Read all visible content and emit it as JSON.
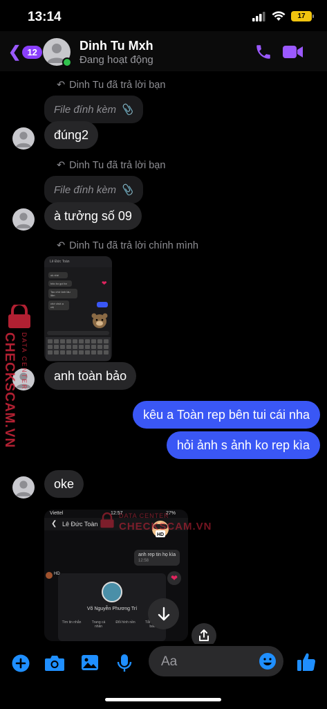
{
  "status": {
    "time": "13:14",
    "battery": "17"
  },
  "header": {
    "back_count": "12",
    "name": "Dinh Tu Mxh",
    "presence": "Đang hoạt động"
  },
  "messages": {
    "reply1_note": "Dinh Tu đã trả lời bạn",
    "reply1_quote": "File đính kèm",
    "msg1": "đúng2",
    "reply2_note": "Dinh Tu đã trả lời bạn",
    "reply2_quote": "File đính kèm",
    "msg2": "à tưởng số 09",
    "reply3_note": "Dinh Tu đã trả lời chính mình",
    "msg3": "anh toàn bảo",
    "out1": "kêu a Toàn rep bên tui cái nha",
    "out2": "hỏi ảnh s ảnh ko rep kìa",
    "msg4": "oke"
  },
  "thumb_small": {
    "title": "Lê Đức Toàn",
    "lines": [
      "ok nhé",
      "bảo ko gọi ko",
      "Tao chờ ảnh lâu lắm",
      "chờ chút ạ chị"
    ],
    "input_ph": "Tin nhắn"
  },
  "shot_big": {
    "carrier": "Viettel",
    "time": "12:57",
    "battery": "27%",
    "contact": "Lê Đức Toàn",
    "bubble": "anh rep tin họ kìa",
    "bubble_time": "12:58",
    "profile_name": "Võ Nguyễn Phương Trí",
    "actions": [
      "Tìm tin nhắn",
      "Trang cá nhân",
      "Đổi hình nền",
      "Tắt thông báo"
    ],
    "badge": "HD"
  },
  "watermark": {
    "brand": "CHECKSCAM.VN",
    "sub": "DATA CENTER"
  },
  "composer": {
    "placeholder": "Aa"
  },
  "colors": {
    "accent": "#8a3ffc",
    "outgoing": "#3a57f5",
    "icon_blue": "#1f8fff",
    "watermark": "#d1263b"
  }
}
